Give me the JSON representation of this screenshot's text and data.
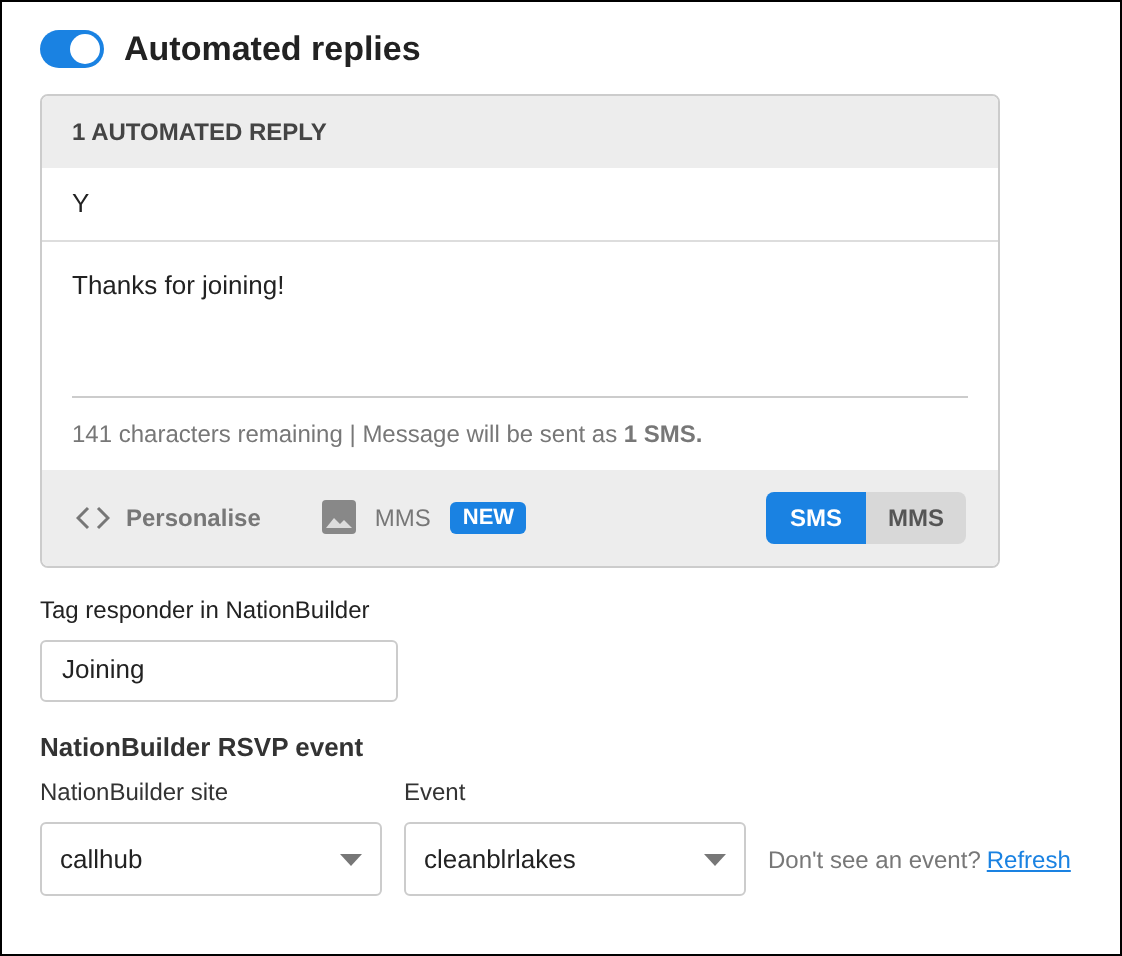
{
  "automated_replies": {
    "title": "Automated replies",
    "on": true
  },
  "reply_card": {
    "header": "1 AUTOMATED REPLY",
    "keyword": "Y",
    "message": "Thanks for joining!",
    "counter": "141 characters remaining | Message will be sent as **1 SMS.**",
    "personalise": "Personalise",
    "mms_label": "MMS",
    "new_badge": "NEW",
    "modes": [
      {
        "label": "SMS",
        "selected": true
      },
      {
        "label": "MMS",
        "selected": false
      }
    ]
  },
  "tag": {
    "label": "Tag responder in NationBuilder",
    "value": "Joining"
  },
  "rsvp": {
    "heading": "NationBuilder RSVP event",
    "selects": [
      {
        "label": "NationBuilder site",
        "value": "callhub"
      },
      {
        "label": "Event",
        "value": "cleanblrlakes"
      }
    ],
    "hint": "Don't see an event?",
    "link": "Refresh"
  }
}
